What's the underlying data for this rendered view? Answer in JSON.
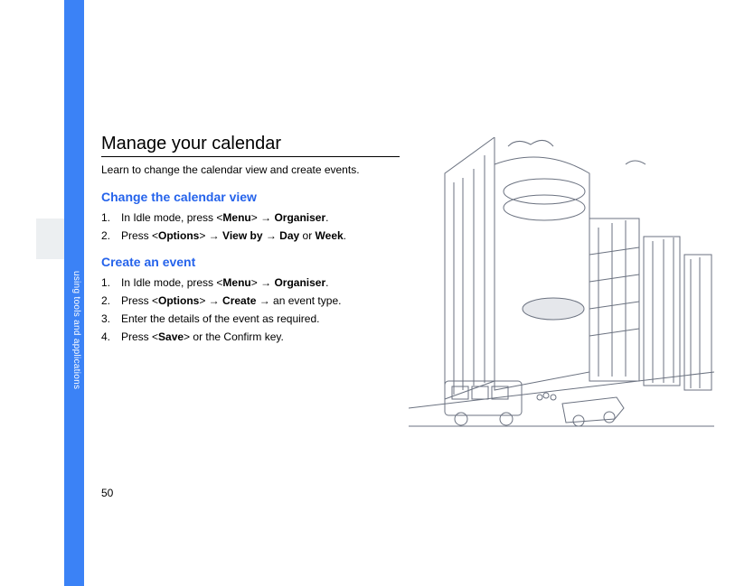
{
  "sidebar": {
    "label": "using tools and applications"
  },
  "page": {
    "number": "50",
    "title": "Manage your calendar",
    "intro": "Learn to change the calendar view and create events."
  },
  "sections": {
    "changeView": {
      "heading": "Change the calendar view",
      "steps": [
        {
          "num": "1.",
          "pre": "In Idle mode, press <",
          "b1": "Menu",
          "post1": "> → ",
          "b2": "Organiser",
          "post2": "."
        },
        {
          "num": "2.",
          "pre": "Press <",
          "b1": "Options",
          "post1": "> → ",
          "b2": "View by",
          "post2": " → ",
          "b3": "Day",
          "post3": " or ",
          "b4": "Week",
          "post4": "."
        }
      ]
    },
    "createEvent": {
      "heading": "Create an event",
      "steps": [
        {
          "num": "1.",
          "pre": "In Idle mode, press <",
          "b1": "Menu",
          "post1": "> → ",
          "b2": "Organiser",
          "post2": "."
        },
        {
          "num": "2.",
          "pre": "Press <",
          "b1": "Options",
          "post1": "> → ",
          "b2": "Create",
          "post2": " → an event type."
        },
        {
          "num": "3.",
          "text": "Enter the details of the event as required."
        },
        {
          "num": "4.",
          "pre": "Press <",
          "b1": "Save",
          "post1": "> or the Confirm key."
        }
      ]
    }
  }
}
